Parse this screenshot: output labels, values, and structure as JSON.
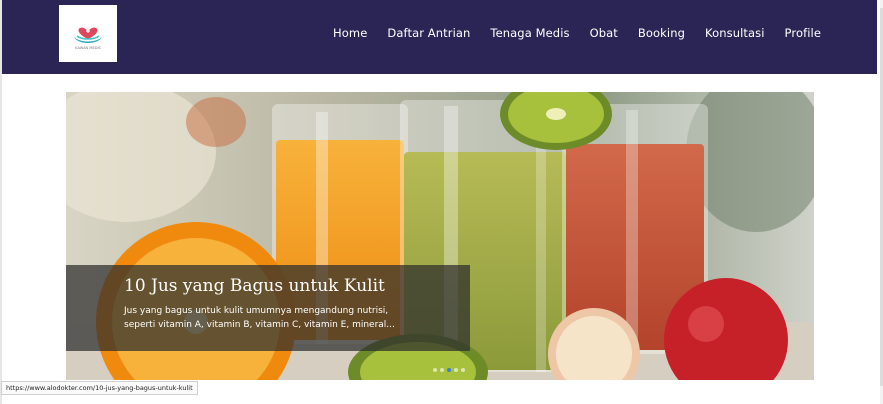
{
  "navbar": {
    "background": "#2b2555",
    "logo": {
      "icon": "heart-hands-logo-icon",
      "text": "KAWAN MEDIS"
    },
    "items": [
      {
        "label": "Home"
      },
      {
        "label": "Daftar Antrian"
      },
      {
        "label": "Tenaga Medis"
      },
      {
        "label": "Obat"
      },
      {
        "label": "Booking"
      },
      {
        "label": "Konsultasi"
      },
      {
        "label": "Profile"
      }
    ]
  },
  "carousel": {
    "image": "juice-glasses-photo",
    "slide_title": "10 Jus yang Bagus untuk Kulit",
    "slide_description": "Jus yang bagus untuk kulit umumnya mengandung nutrisi, seperti vitamin A, vitamin B, vitamin C, vitamin E, mineral...",
    "indicators": 5,
    "active_indicator": 3
  },
  "status_bar": {
    "url": "https://www.alodokter.com/10-jus-yang-bagus-untuk-kulit"
  }
}
